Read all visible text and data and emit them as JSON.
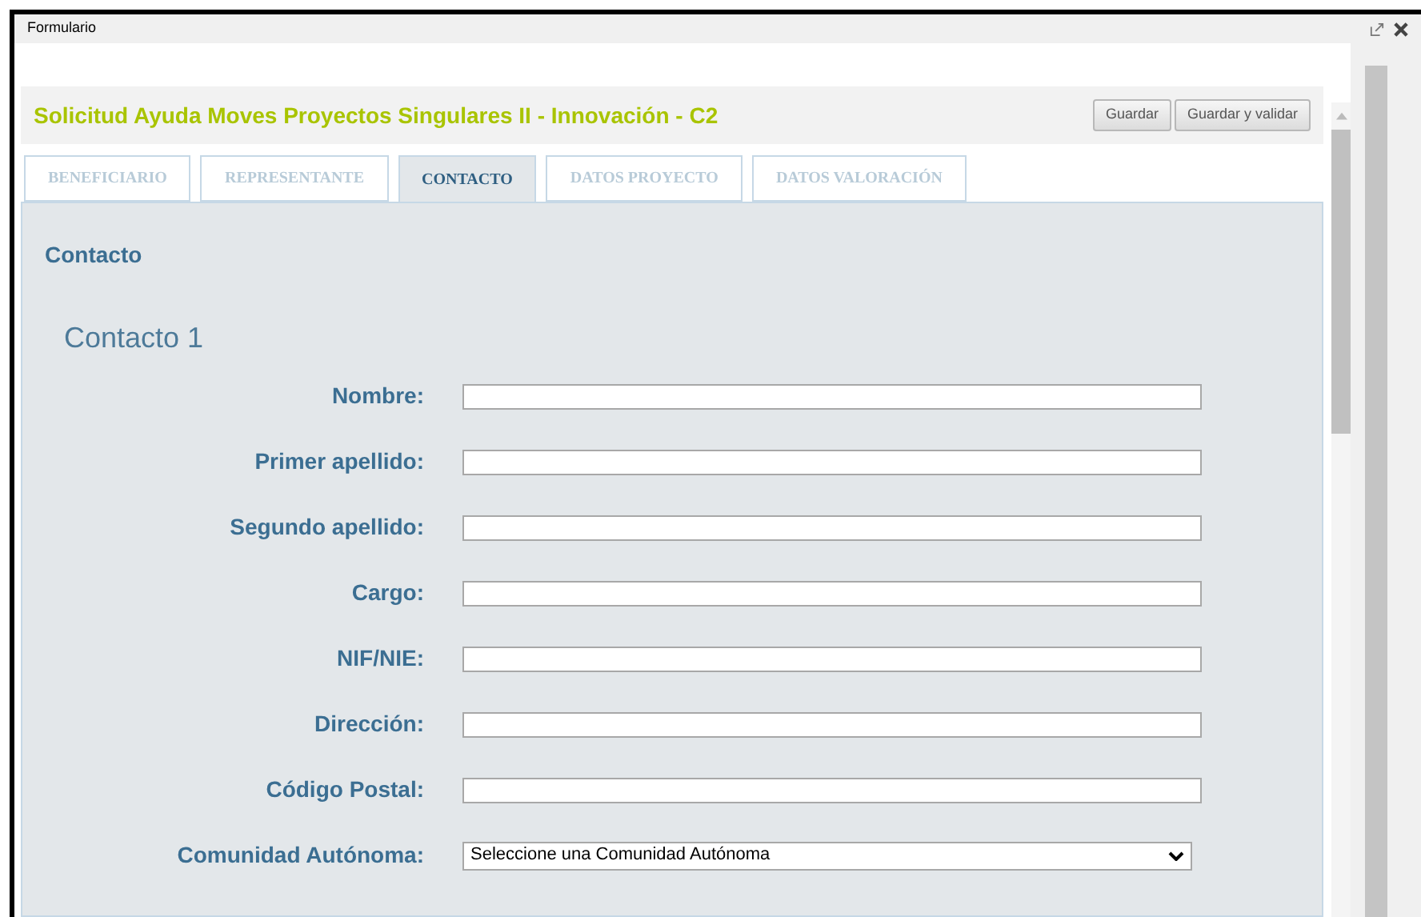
{
  "window": {
    "title": "Formulario"
  },
  "header": {
    "title": "Solicitud Ayuda Moves Proyectos Singulares II - Innovación - C2",
    "buttons": [
      "Guardar",
      "Guardar y validar"
    ]
  },
  "tabs": [
    {
      "label": "BENEFICIARIO",
      "selected": false
    },
    {
      "label": "REPRESENTANTE",
      "selected": false
    },
    {
      "label": "CONTACTO",
      "selected": true
    },
    {
      "label": "DATOS PROYECTO",
      "selected": false
    },
    {
      "label": "DATOS VALORACIÓN",
      "selected": false
    }
  ],
  "section": {
    "title": "Contacto",
    "subtitle": "Contacto 1"
  },
  "fields": [
    {
      "kind": "text",
      "label": "Nombre:"
    },
    {
      "kind": "text",
      "label": "Primer apellido:"
    },
    {
      "kind": "text",
      "label": "Segundo apellido:"
    },
    {
      "kind": "text",
      "label": "Cargo:"
    },
    {
      "kind": "text",
      "label": "NIF/NIE:"
    },
    {
      "kind": "text",
      "label": "Dirección:"
    },
    {
      "kind": "text",
      "label": "Código Postal:"
    },
    {
      "kind": "select",
      "label": "Comunidad Autónoma:",
      "value": "Seleccione una Comunidad Autónoma"
    }
  ]
}
